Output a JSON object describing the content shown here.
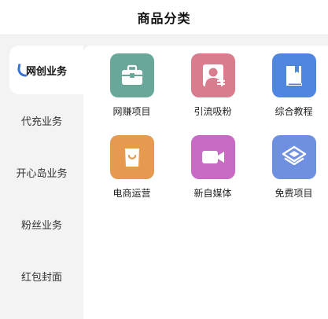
{
  "header": {
    "title": "商品分类"
  },
  "sidebar": {
    "items": [
      {
        "label": "网创业务",
        "active": true
      },
      {
        "label": "代充业务",
        "active": false
      },
      {
        "label": "开心岛业务",
        "active": false
      },
      {
        "label": "粉丝业务",
        "active": false
      },
      {
        "label": "红包封面",
        "active": false
      }
    ],
    "accent_color": "#3b6fd8"
  },
  "categories": [
    {
      "label": "网赚项目",
      "icon": "briefcase-icon",
      "color": "#6aa79b"
    },
    {
      "label": "引流吸粉",
      "icon": "user-badge-icon",
      "color": "#d97c8d"
    },
    {
      "label": "综合教程",
      "icon": "book-icon",
      "color": "#4f86df"
    },
    {
      "label": "电商运营",
      "icon": "shopping-bag-icon",
      "color": "#e59a50"
    },
    {
      "label": "新自媒体",
      "icon": "video-camera-icon",
      "color": "#c86bc4"
    },
    {
      "label": "免费项目",
      "icon": "layers-icon",
      "color": "#6f8fe0"
    }
  ]
}
